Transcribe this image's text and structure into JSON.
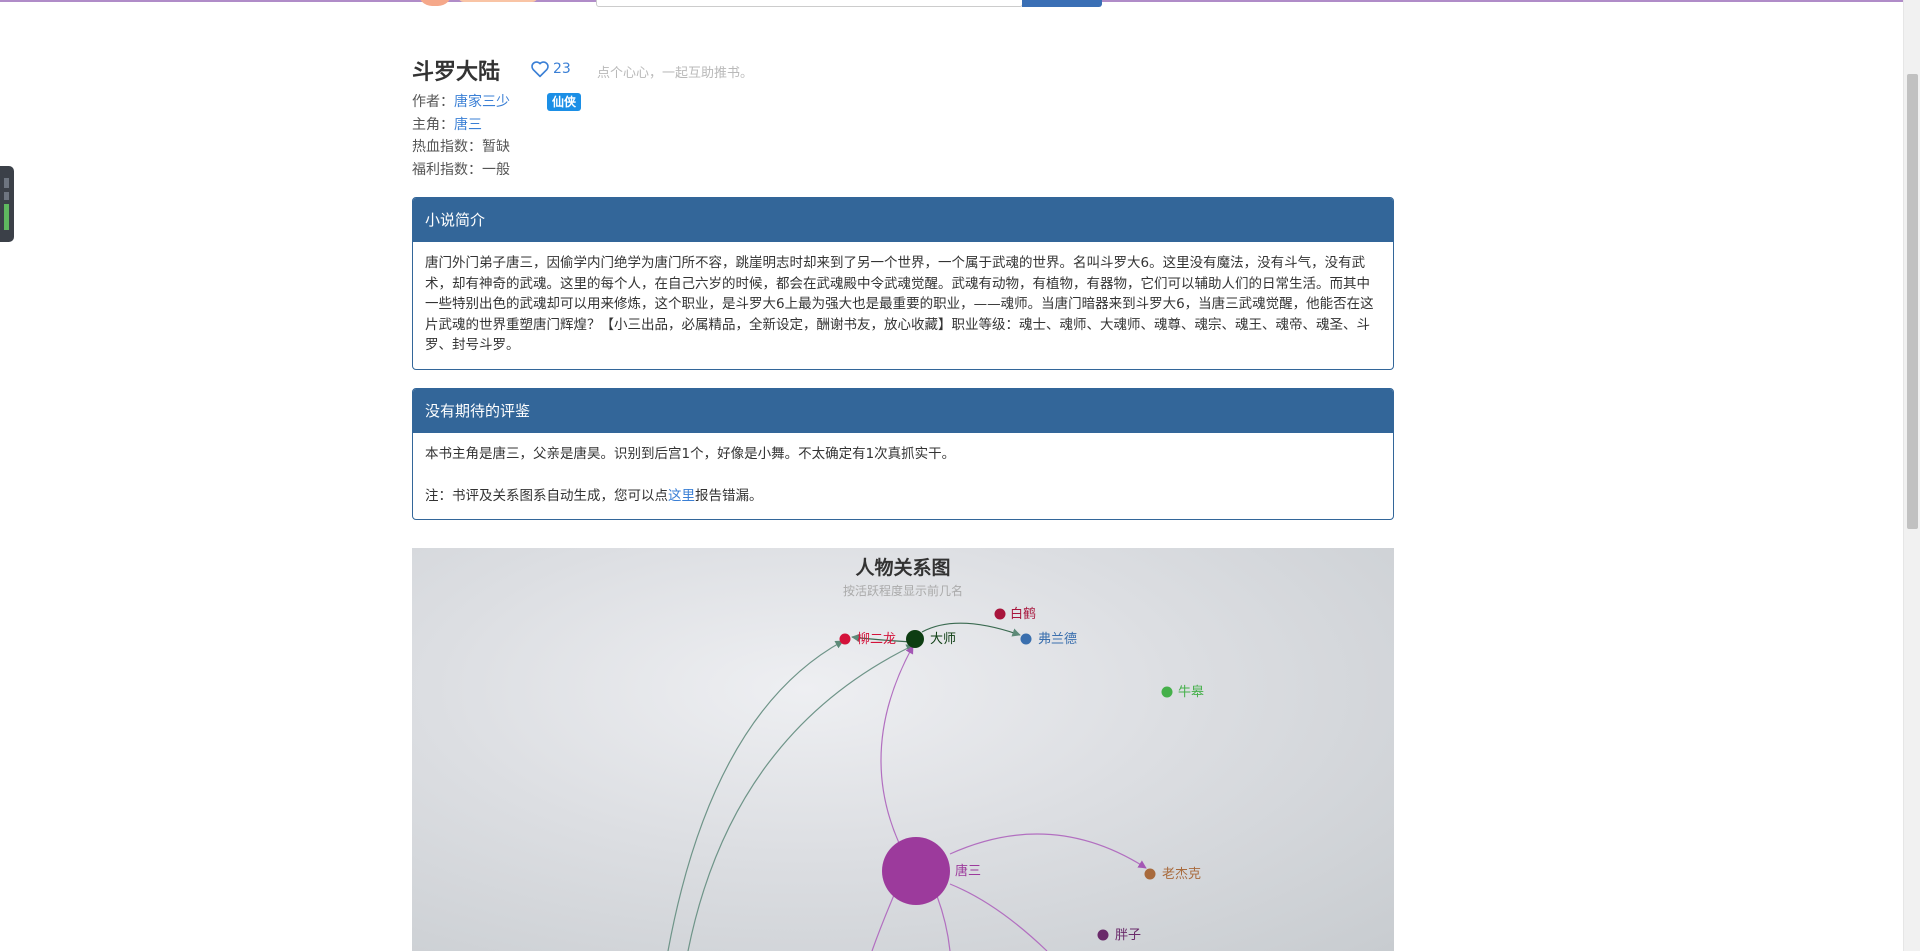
{
  "book": {
    "title": "斗罗大陆",
    "likes": "23",
    "like_hint": "点个心心，一起互助推书。",
    "tag": "仙侠",
    "meta": [
      {
        "label": "作者：",
        "value": "唐家三少",
        "link": true
      },
      {
        "label": "主角：",
        "value": "唐三",
        "link": true
      },
      {
        "label": "热血指数：",
        "value": "暂缺",
        "link": false
      },
      {
        "label": "福利指数：",
        "value": "一般",
        "link": false
      }
    ]
  },
  "intro": {
    "heading": "小说简介",
    "text": "唐门外门弟子唐三，因偷学内门绝学为唐门所不容，跳崖明志时却来到了另一个世界，一个属于武魂的世界。名叫斗罗大6。这里没有魔法，没有斗气，没有武术，却有神奇的武魂。这里的每个人，在自己六岁的时候，都会在武魂殿中令武魂觉醒。武魂有动物，有植物，有器物，它们可以辅助人们的日常生活。而其中一些特别出色的武魂却可以用来修炼，这个职业，是斗罗大6上最为强大也是最重要的职业，——魂师。当唐门暗器来到斗罗大6，当唐三武魂觉醒，他能否在这片武魂的世界重塑唐门辉煌？【小三出品，必属精品，全新设定，酬谢书友，放心收藏】职业等级：魂士、魂师、大魂师、魂尊、魂宗、魂王、魂帝、魂圣、斗罗、封号斗罗。"
  },
  "review": {
    "heading": "没有期待的评鉴",
    "text": "本书主角是唐三，父亲是唐昊。识别到后宫1个，好像是小舞。不太确定有1次真抓实干。",
    "note_prefix": "注：书评及关系图系自动生成，您可以点",
    "note_link": "这里",
    "note_suffix": "报告错漏。"
  },
  "graph": {
    "title": "人物关系图",
    "subtitle": "按活跃程度显示前几名",
    "nodes": [
      {
        "id": "tangsan",
        "label": "唐三",
        "color": "#9c3a9c"
      },
      {
        "id": "dashi",
        "label": "大师",
        "color": "#0d3d12"
      },
      {
        "id": "liuerlong",
        "label": "柳二龙",
        "color": "#d4123a"
      },
      {
        "id": "baihe",
        "label": "白鹤",
        "color": "#a8153c"
      },
      {
        "id": "fulande",
        "label": "弗兰德",
        "color": "#3a6fae"
      },
      {
        "id": "niugao",
        "label": "牛皋",
        "color": "#45b04a"
      },
      {
        "id": "laojieke",
        "label": "老杰克",
        "color": "#a86a3c"
      },
      {
        "id": "pangzi",
        "label": "胖子",
        "color": "#6a2a6a"
      }
    ]
  }
}
